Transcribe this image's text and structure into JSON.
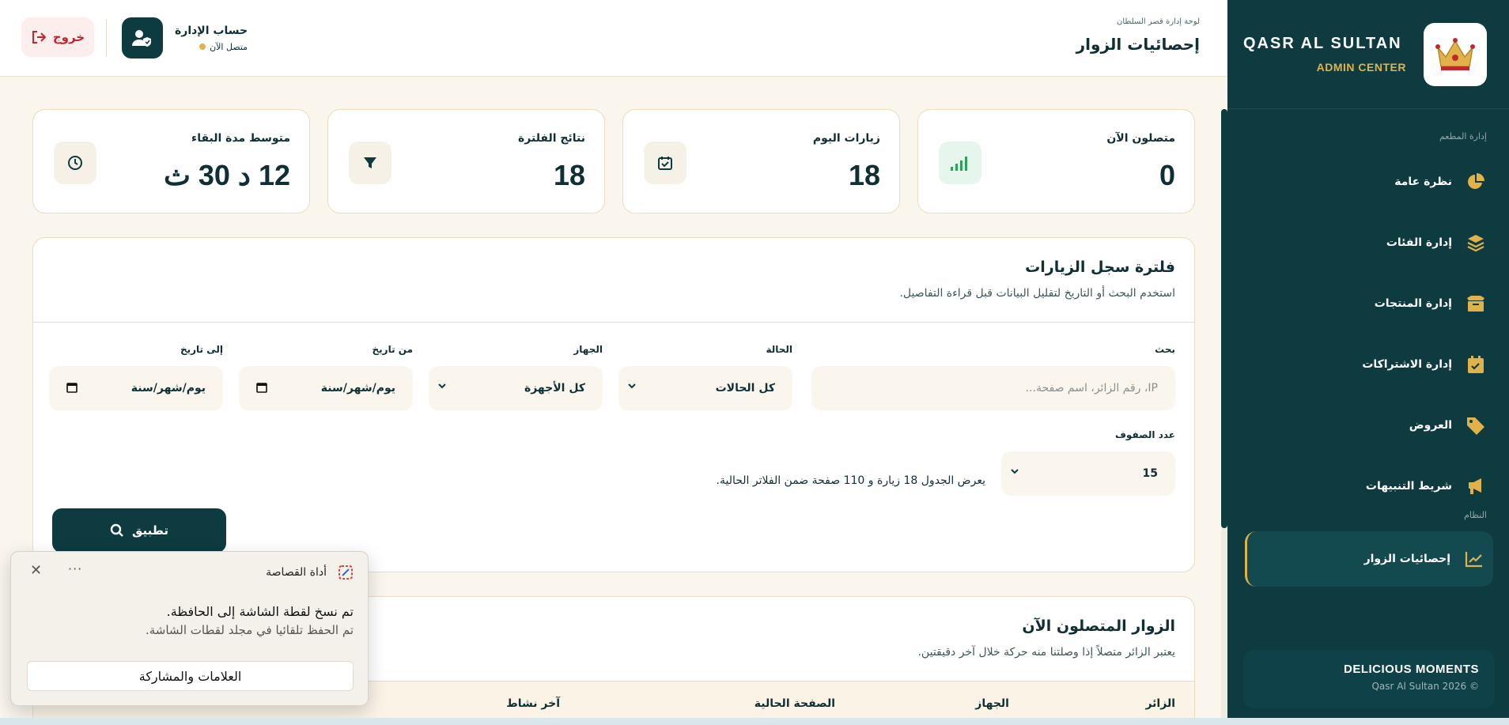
{
  "sidebar": {
    "brand_title": "QASR AL SULTAN",
    "brand_sub": "ADMIN CENTER",
    "section_restaurant": "إدارة المطعم",
    "items": [
      {
        "label": "نظرة عامة",
        "icon": "pie-chart-icon"
      },
      {
        "label": "إدارة الفئات",
        "icon": "layers-icon"
      },
      {
        "label": "إدارة المنتجات",
        "icon": "box-icon"
      },
      {
        "label": "إدارة الاشتراكات",
        "icon": "calendar-check-icon"
      },
      {
        "label": "العروض",
        "icon": "tag-icon"
      },
      {
        "label": "شريط التنبيهات",
        "icon": "megaphone-icon"
      }
    ],
    "section_system": "النظام",
    "active_item": {
      "label": "إحصائيات الزوار",
      "icon": "chart-line-icon"
    },
    "footer_title": "DELICIOUS MOMENTS",
    "footer_copy": "Qasr Al Sultan 2026 ©"
  },
  "header": {
    "breadcrumb": "لوحة إدارة قصر السلطان",
    "title": "إحصائيات الزوار",
    "account_name": "حساب الإدارة",
    "account_status": "متصل الآن",
    "logout_label": "خروج"
  },
  "stats": [
    {
      "label": "متصلون الآن",
      "value": "0",
      "icon": "signal-icon"
    },
    {
      "label": "زيارات اليوم",
      "value": "18",
      "icon": "calendar-check-icon"
    },
    {
      "label": "نتائج الفلترة",
      "value": "18",
      "icon": "filter-icon"
    },
    {
      "label": "متوسط مدة البقاء",
      "value": "12 د 30 ث",
      "icon": "clock-icon"
    }
  ],
  "filter": {
    "title": "فلترة سجل الزيارات",
    "subtitle": "استخدم البحث أو التاريخ لتقليل البيانات قبل قراءة التفاصيل.",
    "search_label": "بحث",
    "search_placeholder": "IP، رقم الزائر، اسم صفحة...",
    "status_label": "الحالة",
    "status_value": "كل الحالات",
    "device_label": "الجهاز",
    "device_value": "كل الأجهزة",
    "from_label": "من تاريخ",
    "from_value": "يوم/شهر/سنة",
    "to_label": "إلى تاريخ",
    "to_value": "يوم/شهر/سنة",
    "rows_label": "عدد الصفوف",
    "rows_value": "15",
    "summary": "يعرض الجدول 18 زيارة و 110 صفحة ضمن الفلاتر الحالية.",
    "apply_label": "تطبيق"
  },
  "online": {
    "title": "الزوار المتصلون الآن",
    "subtitle": "يعتبر الزائر متصلاً إذا وصلتنا منه حركة خلال آخر دقيقتين.",
    "columns": [
      "الزائر",
      "الجهاز",
      "الصفحة الحالية",
      "آخر نشاط"
    ]
  },
  "toast": {
    "app_name": "أداة القصاصة",
    "message": "تم نسخ لقطة الشاشة إلى الحافظة.",
    "detail": "تم الحفظ تلقائيا في مجلد لقطات الشاشة.",
    "button": "العلامات والمشاركة"
  },
  "colors": {
    "primary": "#0d3b40",
    "accent": "#e2b24a",
    "danger": "#c0262d",
    "background": "#faf6ee"
  }
}
